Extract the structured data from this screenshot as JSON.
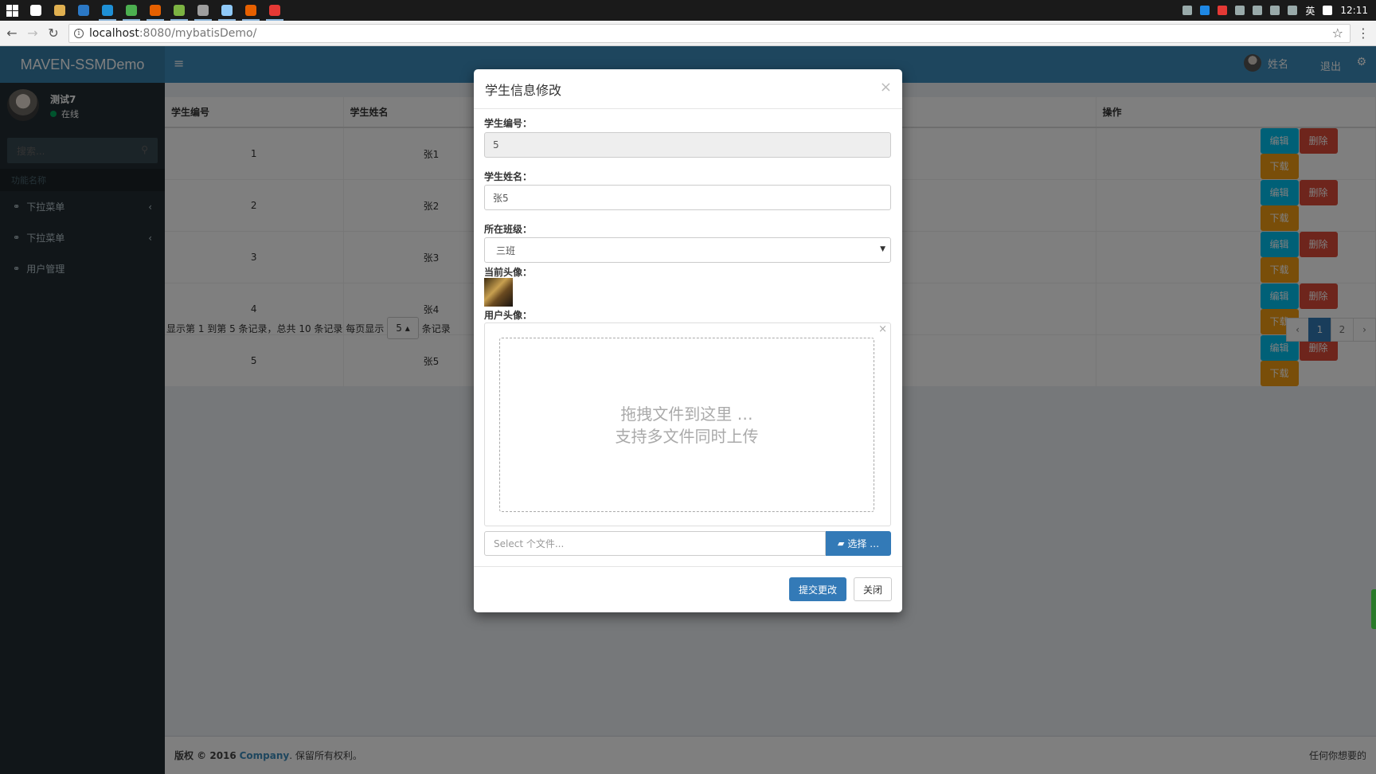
{
  "taskbar": {
    "apps": [
      {
        "icon": "chat-icon",
        "color": "#ffffff"
      },
      {
        "icon": "folder-icon",
        "color": "#e0b050"
      },
      {
        "icon": "calendar-icon",
        "color": "#2b78c5"
      },
      {
        "icon": "edge-icon",
        "color": "#1e90d6"
      },
      {
        "icon": "chrome-icon",
        "color": "#4caf50"
      },
      {
        "icon": "firefox-icon",
        "color": "#e66000"
      },
      {
        "icon": "notepad-icon",
        "color": "#7cb342"
      },
      {
        "icon": "settings-icon",
        "color": "#9e9e9e"
      },
      {
        "icon": "file-icon",
        "color": "#90caf9"
      },
      {
        "icon": "firefox-icon",
        "color": "#e66000"
      },
      {
        "icon": "weibo-icon",
        "color": "#e53935"
      }
    ],
    "lang": "英",
    "clock": "12:11"
  },
  "browser": {
    "url_host": "localhost",
    "url_path": ":8080/mybatisDemo/"
  },
  "header": {
    "logo": "MAVEN-SSMDemo",
    "user_name": "姓名",
    "logout": "退出"
  },
  "sidebar": {
    "user_name": "测试7",
    "status": "在线",
    "search_placeholder": "搜索...",
    "section": "功能名称",
    "items": [
      {
        "label": "下拉菜单"
      },
      {
        "label": "下拉菜单"
      },
      {
        "label": "用户管理"
      }
    ]
  },
  "table": {
    "columns": [
      "学生编号",
      "学生姓名",
      "操作"
    ],
    "rows": [
      {
        "id": "1",
        "name": "张1"
      },
      {
        "id": "2",
        "name": "张2"
      },
      {
        "id": "3",
        "name": "张3"
      },
      {
        "id": "4",
        "name": "张4"
      },
      {
        "id": "5",
        "name": "张5"
      }
    ],
    "btn_edit": "编辑",
    "btn_delete": "删除",
    "btn_download": "下载"
  },
  "pager": {
    "info_prefix": "显示第 1 到第 5 条记录，总共 10 条记录 每页显示",
    "page_size": "5",
    "info_suffix": "条记录",
    "prev": "‹",
    "pages": [
      "1",
      "2"
    ],
    "next": "›"
  },
  "footer": {
    "copyright": "版权 © 2016",
    "company": "Company",
    "rights": ". 保留所有权利。",
    "right_text": "任何你想要的"
  },
  "modal": {
    "title": "学生信息修改",
    "close": "×",
    "id_label": "学生编号：",
    "id_value": "5",
    "name_label": "学生姓名：",
    "name_value": "张5",
    "class_label": "所在班级：",
    "class_value": "三班",
    "current_avatar_label": "当前头像：",
    "user_avatar_label": "用户头像：",
    "drop_line1": "拖拽文件到这里 …",
    "drop_line2": "支持多文件同时上传",
    "file_placeholder": "Select 个文件...",
    "choose_btn": "选择 …",
    "submit": "提交更改",
    "cancel": "关闭"
  }
}
